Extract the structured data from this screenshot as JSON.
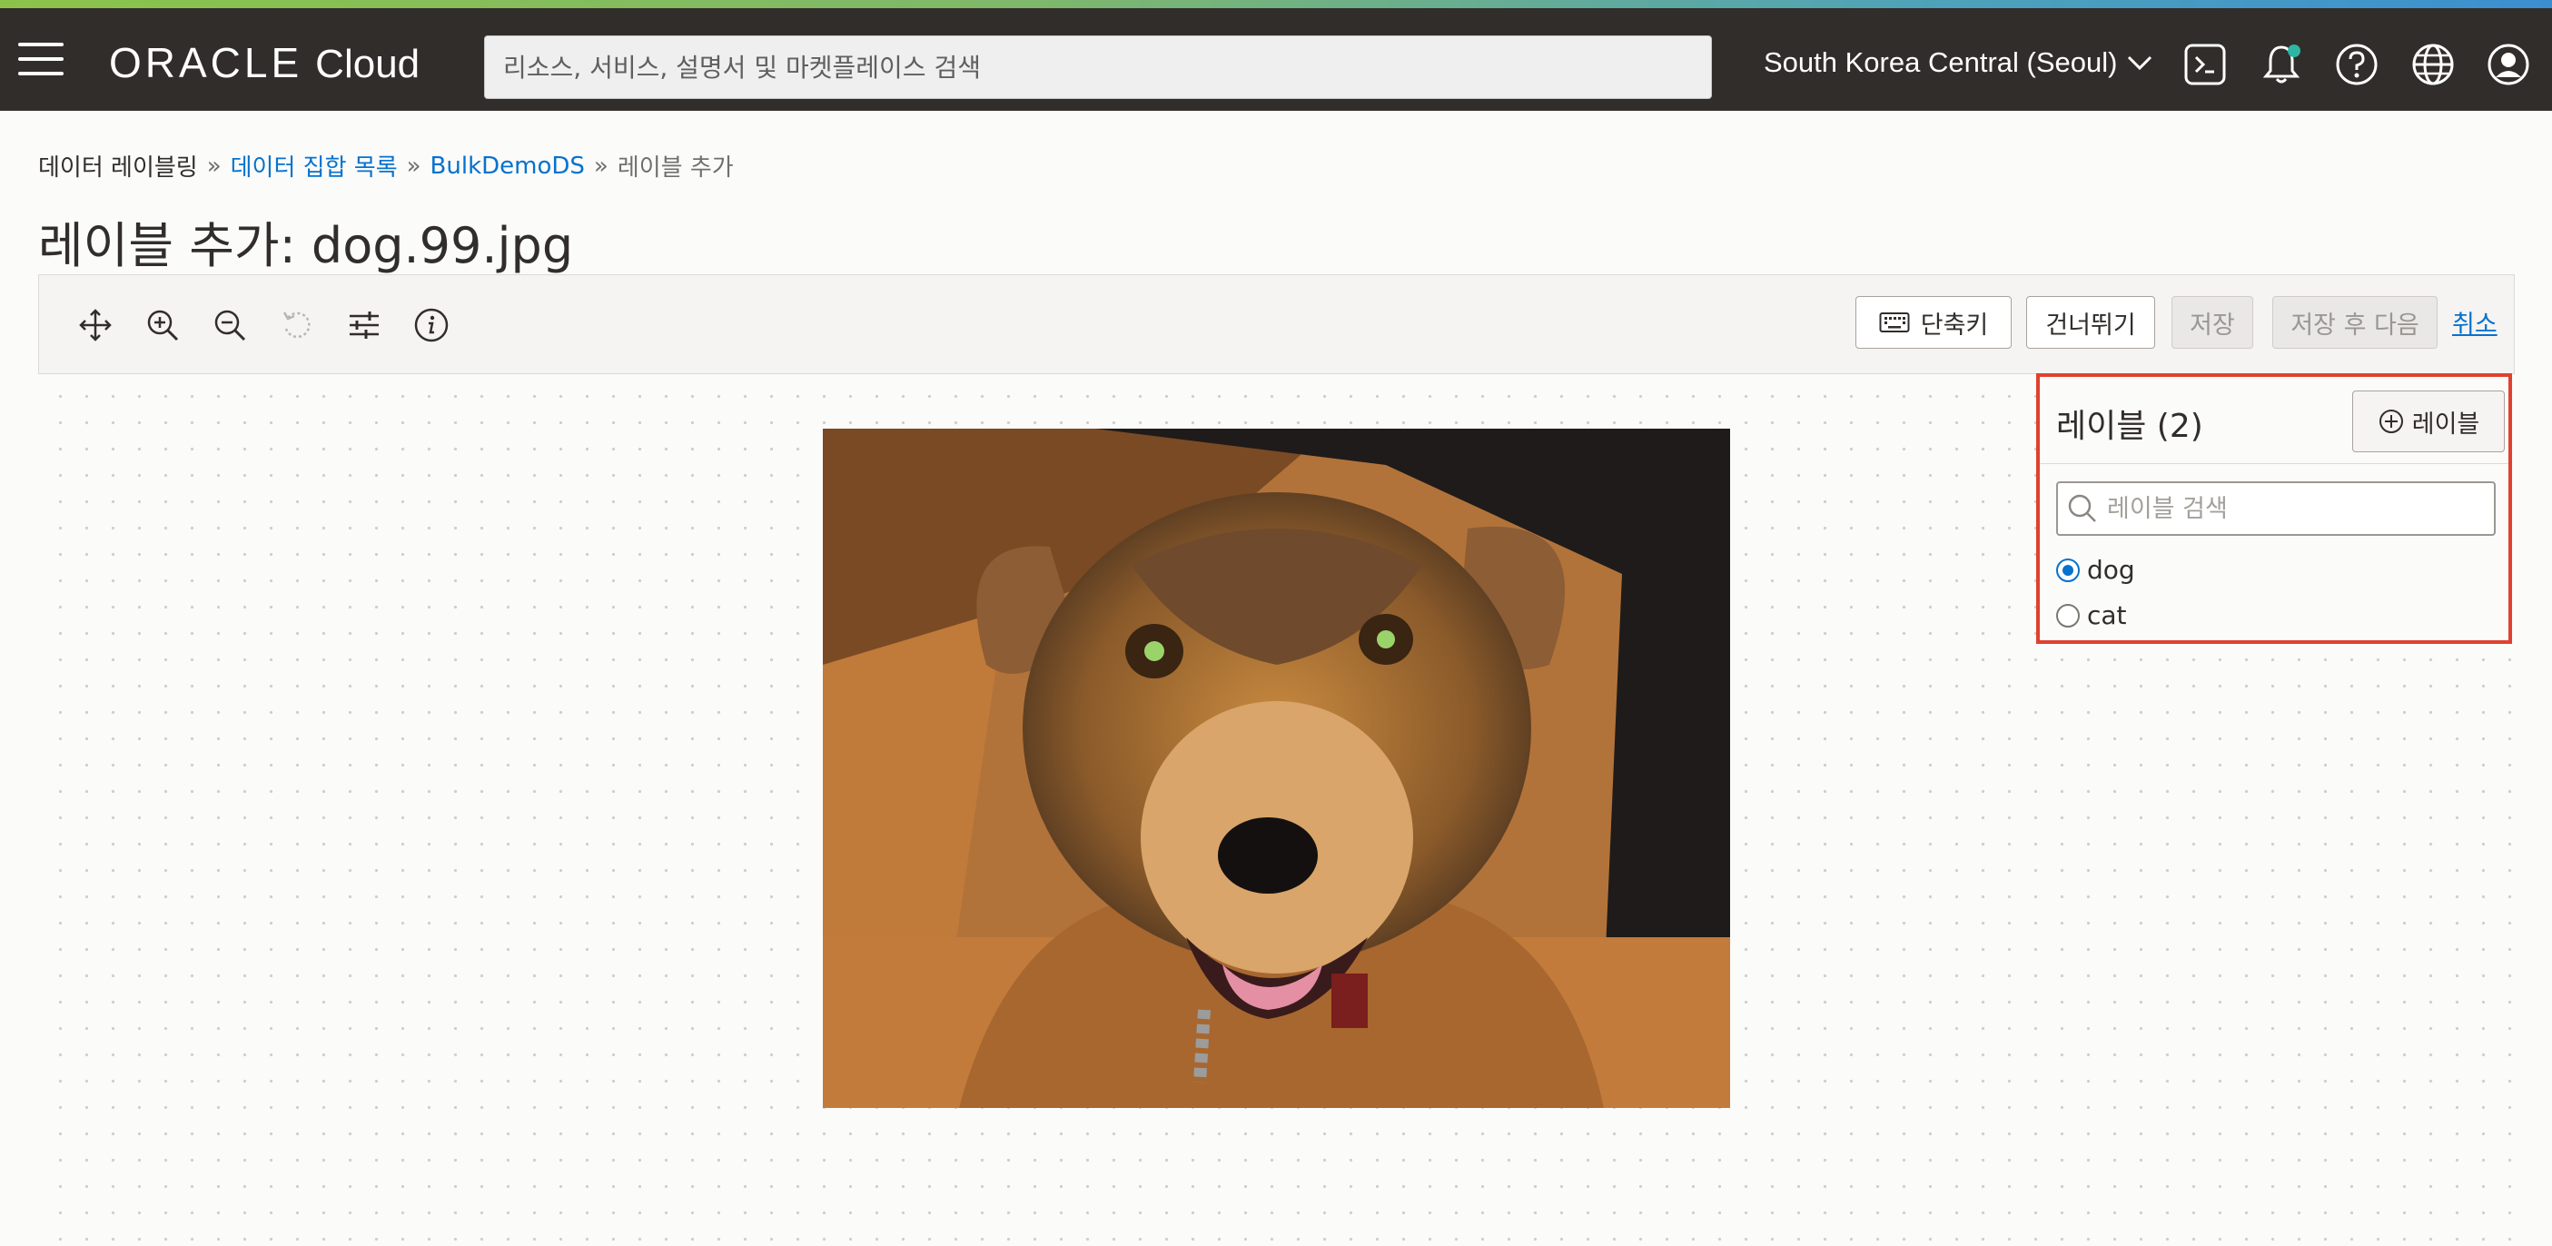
{
  "header": {
    "brand": "ORACLE",
    "product": "Cloud",
    "search_placeholder": "리소스, 서비스, 설명서 및 마켓플레이스 검색",
    "region": "South Korea Central (Seoul)"
  },
  "breadcrumb": {
    "items": [
      {
        "label": "데이터 레이블링",
        "link": false
      },
      {
        "label": "데이터 집합 목록",
        "link": true
      },
      {
        "label": "BulkDemoDS",
        "link": true
      },
      {
        "label": "레이블 추가",
        "link": false
      }
    ],
    "separator": "»"
  },
  "page": {
    "title": "레이블 추가: dog.99.jpg"
  },
  "toolbar": {
    "shortcuts_label": "단축키",
    "skip_label": "건너뛰기",
    "save_label": "저장",
    "save_next_label": "저장 후 다음",
    "cancel_label": "취소"
  },
  "labels_panel": {
    "title": "레이블 (2)",
    "add_button_label": "레이블",
    "search_placeholder": "레이블 검색",
    "options": [
      {
        "label": "dog",
        "selected": true
      },
      {
        "label": "cat",
        "selected": false
      }
    ]
  },
  "colors": {
    "topbar": "#312d2a",
    "link": "#0572ce",
    "highlight_border": "#e0412f",
    "notification_dot": "#2fb5a4"
  },
  "icons": [
    "hamburger-icon",
    "cloud-shell-icon",
    "bell-icon",
    "help-icon",
    "globe-icon",
    "user-icon",
    "move-icon",
    "zoom-in-icon",
    "zoom-out-icon",
    "reset-icon",
    "adjust-icon",
    "info-icon",
    "keyboard-icon",
    "plus-circle-icon",
    "search-icon",
    "chevron-down-icon"
  ]
}
